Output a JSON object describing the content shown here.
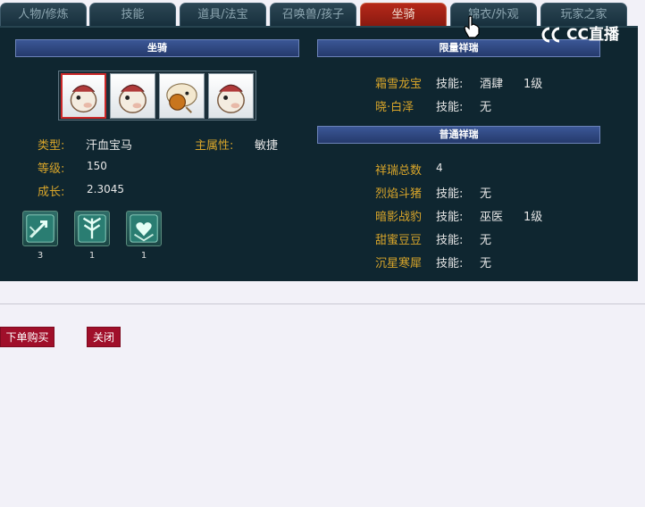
{
  "tabs": [
    {
      "label": "人物/修炼"
    },
    {
      "label": "技能"
    },
    {
      "label": "道具/法宝"
    },
    {
      "label": "召唤兽/孩子"
    },
    {
      "label": "坐骑"
    },
    {
      "label": "锦衣/外观"
    },
    {
      "label": "玩家之家"
    }
  ],
  "active_tab": "坐骑",
  "left": {
    "header": "坐骑",
    "mounts": [
      {
        "icon": "white-horse-icon",
        "selected": true
      },
      {
        "icon": "white-horse-icon",
        "selected": false
      },
      {
        "icon": "sheep-mount-icon",
        "selected": false
      },
      {
        "icon": "white-horse-icon",
        "selected": false
      }
    ],
    "type_label": "类型:",
    "type_value": "汗血宝马",
    "attr_label": "主属性:",
    "attr_value": "敏捷",
    "level_label": "等级:",
    "level_value": "150",
    "growth_label": "成长:",
    "growth_value": "2.3045",
    "skills": [
      {
        "icon": "skill-arrow-icon",
        "count": "3"
      },
      {
        "icon": "skill-wing-icon",
        "count": "1"
      },
      {
        "icon": "skill-heart-icon",
        "count": "1"
      }
    ]
  },
  "limited": {
    "header": "限量祥瑞",
    "rows": [
      {
        "name": "霜雪龙宝",
        "skill_label": "技能:",
        "skill": "酒肆",
        "level": "1级"
      },
      {
        "name": "晓·白泽",
        "skill_label": "技能:",
        "skill": "无",
        "level": ""
      }
    ]
  },
  "normal": {
    "header": "普通祥瑞",
    "total_label": "祥瑞总数",
    "total_value": "4",
    "rows": [
      {
        "name": "烈焰斗猪",
        "skill_label": "技能:",
        "skill": "无",
        "level": ""
      },
      {
        "name": "暗影战豹",
        "skill_label": "技能:",
        "skill": "巫医",
        "level": "1级"
      },
      {
        "name": "甜蜜豆豆",
        "skill_label": "技能:",
        "skill": "无",
        "level": ""
      },
      {
        "name": "沉星寒犀",
        "skill_label": "技能:",
        "skill": "无",
        "level": ""
      }
    ]
  },
  "buttons": {
    "buy": "下单购买",
    "close": "关闭"
  },
  "watermark": {
    "text": "CC直播",
    "icon": "cc-logo-icon"
  },
  "colors": {
    "accent_label": "#d8a52a",
    "active_tab": "#b5281a",
    "button": "#a00f2a",
    "panel": "#0f2630"
  }
}
